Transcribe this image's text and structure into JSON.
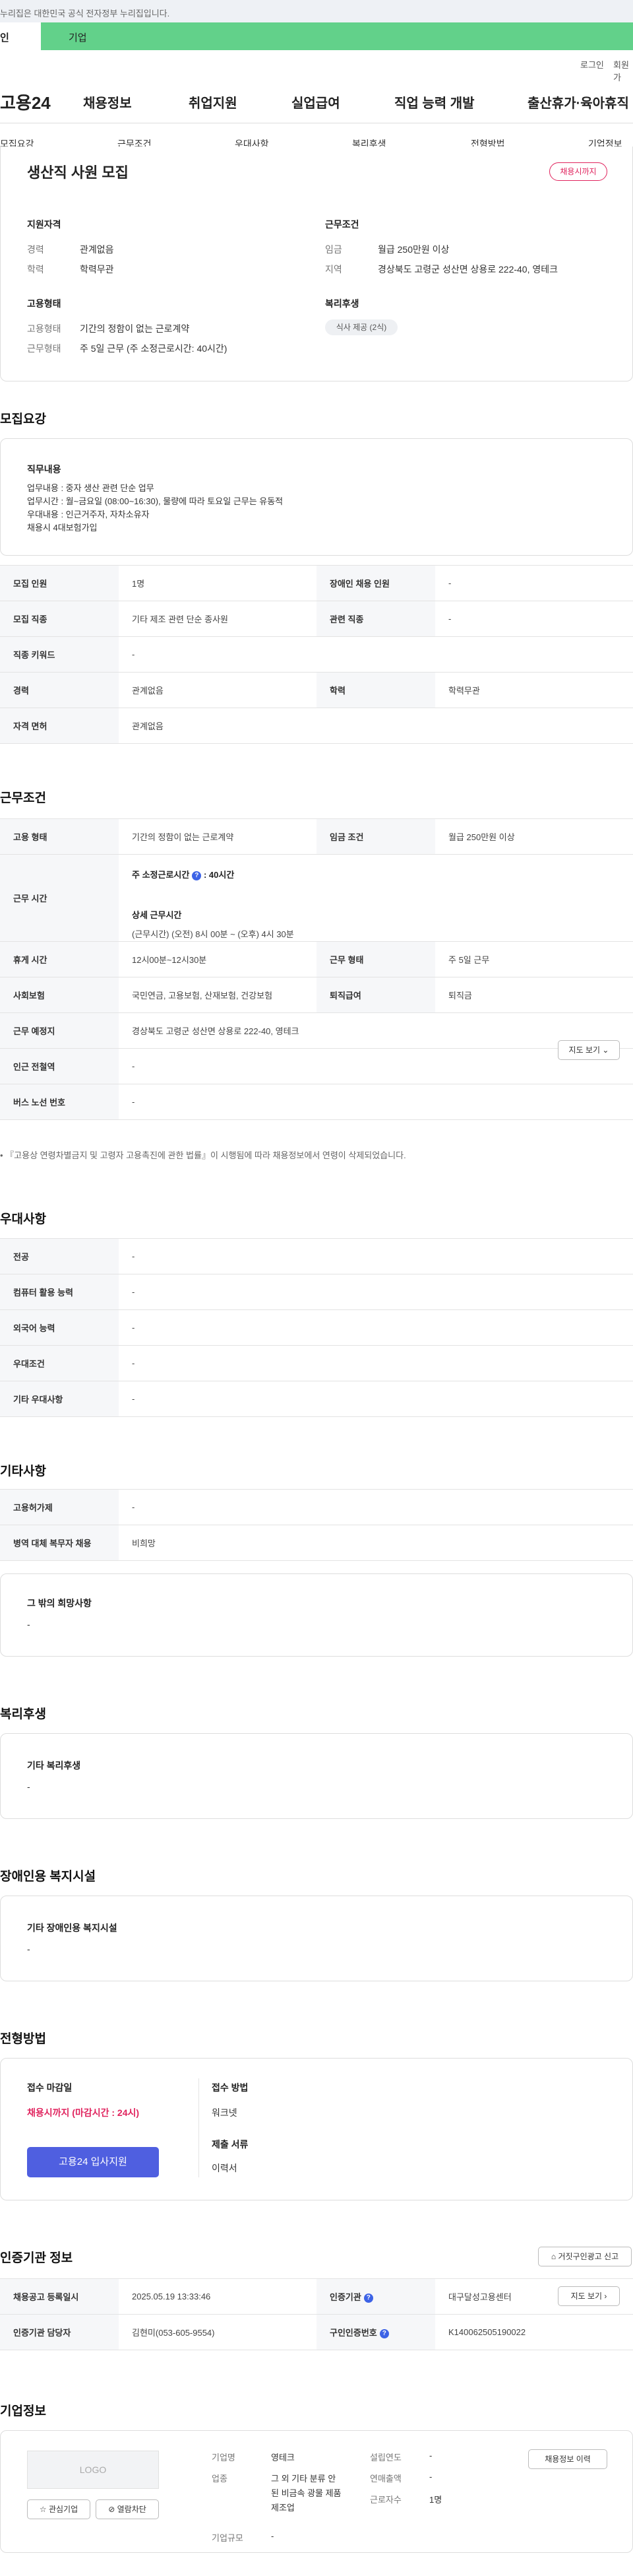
{
  "gov_notice": "누리집은 대한민국 공식 전자정부 누리집입니다.",
  "top_tabs": {
    "individual": "인",
    "business": "기업"
  },
  "util": {
    "login": "로그인",
    "join": "회원가"
  },
  "logo": "고용24",
  "gnb": [
    "채용정보",
    "취업지원",
    "실업급여",
    "직업 능력 개발",
    "출산휴가·육아휴직"
  ],
  "subnav": [
    "모집요강",
    "근무조건",
    "우대사항",
    "복리후생",
    "전형방법",
    "기업정보"
  ],
  "summary": {
    "title": "생산직 사원 모집",
    "badge": "채용시까지",
    "qual_head": "지원자격",
    "career_label": "경력",
    "career_value": "관계없음",
    "edu_label": "학력",
    "edu_value": "학력무관",
    "work_head": "근무조건",
    "wage_label": "임금",
    "wage_value": "월급 250만원 이상",
    "region_label": "지역",
    "region_value": "경상북도 고령군 성산면 상용로 222-40, 영테크",
    "emp_head": "고용형태",
    "emp_label": "고용형태",
    "emp_value": "기간의 정함이 없는 근로계약",
    "form_label": "근무형태",
    "form_value": "주 5일 근무 (주 소정근로시간: 40시간)",
    "welfare_head": "복리후생",
    "welfare_chip": "식사 제공 (2식)"
  },
  "recruit": {
    "heading": "모집요강",
    "duty_head": "직무내용",
    "duty_lines": [
      "업무내용 : 중자 생산 관련 단순 업무",
      "업무시간 : 월~금요일 (08:00~16:30), 물량에 따라 토요일 근무는 유동적",
      "우대내용 : 인근거주자, 자차소유자",
      "채용시 4대보험가입"
    ],
    "rows": [
      [
        "모집 인원",
        "1명",
        "장애인 채용 인원",
        "-"
      ],
      [
        "모집 직종",
        "기타 제조 관련 단순 종사원",
        "관련 직종",
        "-"
      ],
      [
        "직종 키워드",
        "-"
      ],
      [
        "경력",
        "관계없음",
        "학력",
        "학력무관"
      ],
      [
        "자격 면허",
        "관계없음"
      ]
    ]
  },
  "work": {
    "heading": "근무조건",
    "emp_type_label": "고용 형태",
    "emp_type_value": "기간의 정함이 없는 근로계약",
    "wage_label": "임금 조건",
    "wage_value": "월급 250만원 이상",
    "hours_label": "근무 시간",
    "hours_weekly": "주 소정근로시간",
    "hours_weekly_value": ": 40시간",
    "hours_detail_head": "상세 근무시간",
    "hours_detail": "(근무시간) (오전) 8시 00분 ~ (오후) 4시 30분",
    "break_label": "휴게 시간",
    "break_value": "12시00분~12시30분",
    "form_label": "근무 형태",
    "form_value": "주 5일 근무",
    "ins_label": "사회보험",
    "ins_value": "국민연금, 고용보험, 산재보험, 건강보험",
    "retire_label": "퇴직급여",
    "retire_value": "퇴직금",
    "place_label": "근무 예정지",
    "place_value": "경상북도 고령군 성산면 상용로 222-40, 영테크",
    "map_btn": "지도 보기",
    "subway_label": "인근 전철역",
    "subway_value": "-",
    "bus_label": "버스 노선 번호",
    "bus_value": "-",
    "note": "『고용상 연령차별금지 및 고령자 고용촉진에 관한 법률』이 시행됨에 따라 채용정보에서 연령이 삭제되었습니다."
  },
  "pref": {
    "heading": "우대사항",
    "rows": [
      [
        "전공",
        "-"
      ],
      [
        "컴퓨터 활용 능력",
        "-"
      ],
      [
        "외국어 능력",
        "-"
      ],
      [
        "우대조건",
        "-"
      ],
      [
        "기타 우대사항",
        "-"
      ]
    ]
  },
  "etc": {
    "heading": "기타사항",
    "rows": [
      [
        "고용허가제",
        "-"
      ],
      [
        "병역 대체 복무자 채용",
        "비희망"
      ]
    ],
    "box_head": "그 밖의 희망사항",
    "box_value": "-"
  },
  "welfare": {
    "heading": "복리후생",
    "box_head": "기타 복리후생",
    "box_value": "-"
  },
  "disab": {
    "heading": "장애인용 복지시설",
    "box_head": "기타 장애인용 복지시설",
    "box_value": "-"
  },
  "select": {
    "heading": "전형방법",
    "deadline_head": "접수 마감일",
    "deadline_value": "채용시까지 (마감시간 : 24시)",
    "apply_btn": "고용24 입사지원",
    "method_head": "접수 방법",
    "method_value": "워크넷",
    "docs_head": "제출 서류",
    "docs_value": "이력서"
  },
  "agency": {
    "heading": "인증기관 정보",
    "report_btn": "거짓구인광고 신고",
    "reg_label": "채용공고 등록일시",
    "reg_value": "2025.05.19 13:33:46",
    "inst_label": "인증기관",
    "inst_value": "대구달성고용센터",
    "map_btn": "지도 보기",
    "staff_label": "인증기관 담당자",
    "staff_value": "김현미(053-605-9554)",
    "num_label": "구인인증번호",
    "num_value": "K140062505190022"
  },
  "company": {
    "heading": "기업정보",
    "logo_text": "LOGO",
    "fav_btn": "관심기업",
    "block_btn": "열람차단",
    "name_label": "기업명",
    "name_value": "영테크",
    "ind_label": "업종",
    "ind_value": "그 외 기타 분류 안된 비금속 광물 제품 제조업",
    "year_label": "설립연도",
    "year_value": "-",
    "sales_label": "연매출액",
    "sales_value": "-",
    "emp_label": "근로자수",
    "emp_value": "1명",
    "size_label": "기업규모",
    "size_value": "-",
    "history_btn": "채용정보 이력"
  },
  "colors": {
    "accent_green": "#62d18a",
    "badge_red": "#e0245e",
    "apply_blue": "#4f5fe0"
  }
}
